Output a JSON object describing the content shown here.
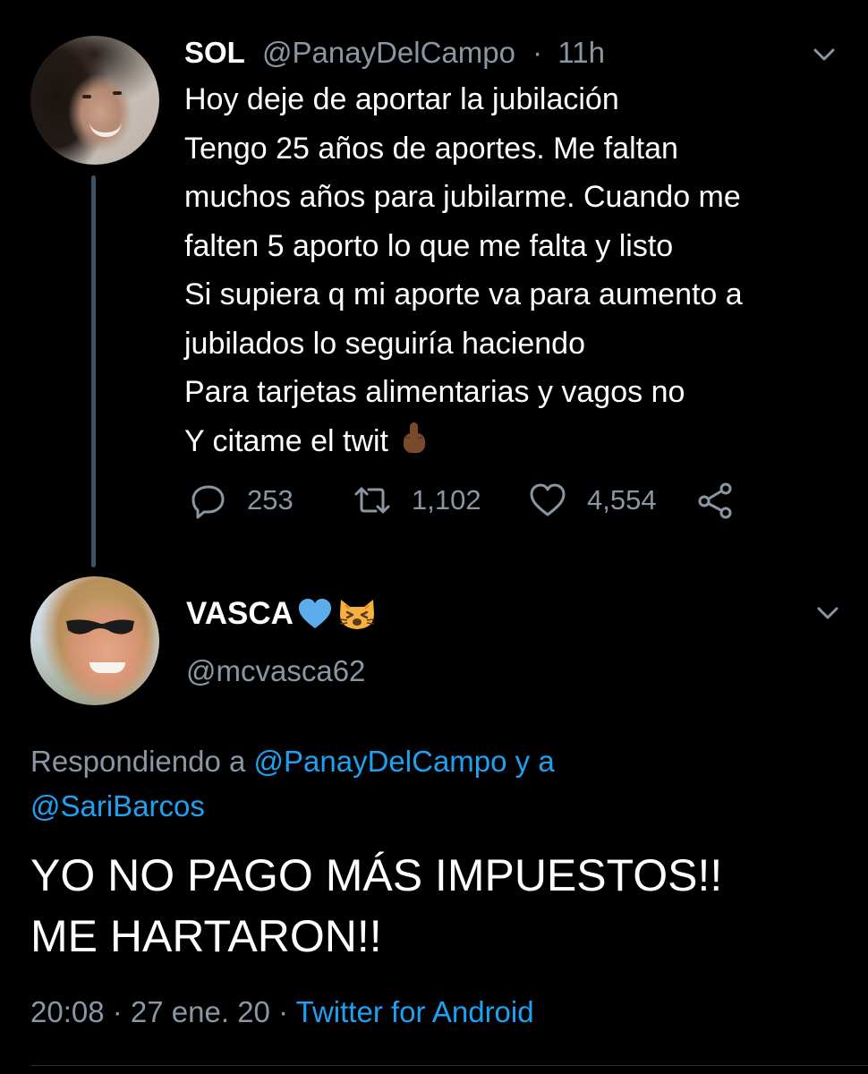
{
  "parent_tweet": {
    "display_name": "SOL",
    "handle": "@PanayDelCampo",
    "separator": "·",
    "time": "11h",
    "lines": [
      "Hoy deje de aportar la jubilación",
      "Tengo 25 años de aportes. Me faltan",
      "muchos años para jubilarme. Cuando me",
      "falten 5 aporto lo que me falta y listo",
      "Si supiera q mi aporte va para aumento a",
      "jubilados lo seguiría haciendo",
      "Para tarjetas alimentarias y vagos no",
      "Y citame el twit"
    ],
    "emoji": "middle-finger-icon",
    "actions": {
      "replies": "253",
      "retweets": "1,102",
      "likes": "4,554"
    }
  },
  "reply_tweet": {
    "display_name": "VASCA",
    "name_emojis": [
      "blue-heart-icon",
      "weary-cat-icon"
    ],
    "handle": "@mcvasca62",
    "replying_prefix": "Respondiendo a ",
    "replying_user1": "@PanayDelCampo",
    "replying_join": " y a",
    "replying_user2": "@SariBarcos",
    "lines": [
      "YO NO PAGO MÁS IMPUESTOS!!",
      "ME HARTARON!!"
    ],
    "time": "20:08",
    "date": "27 ene. 20",
    "separator": " · ",
    "client": "Twitter for Android"
  },
  "colors": {
    "background": "#000000",
    "text": "#ffffff",
    "muted": "#8a97a3",
    "link": "#1da1f2",
    "thread_line": "#3d5466"
  }
}
